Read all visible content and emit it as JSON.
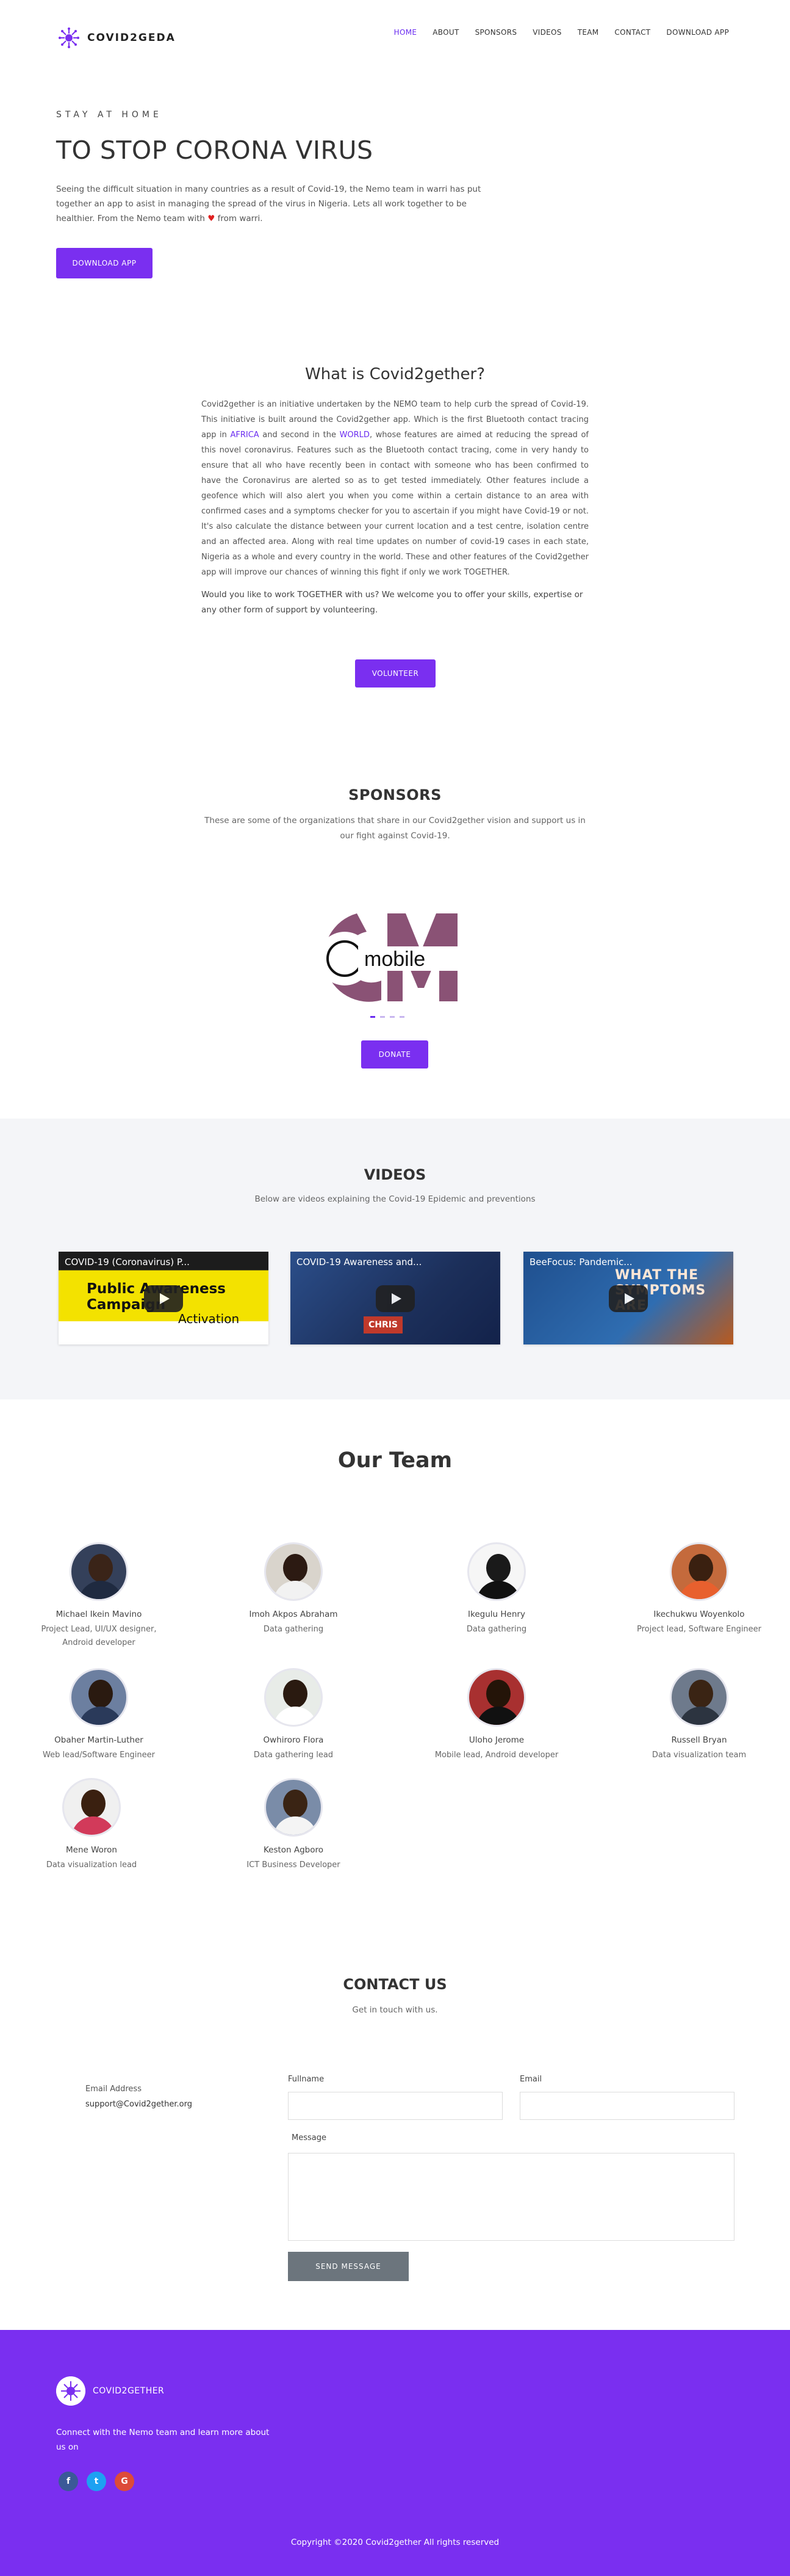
{
  "brand": {
    "name": "COVID2GEDA",
    "accent": "#7a2ff0"
  },
  "nav": {
    "items": [
      {
        "label": "HOME",
        "active": true
      },
      {
        "label": "ABOUT"
      },
      {
        "label": "SPONSORS"
      },
      {
        "label": "VIDEOS"
      },
      {
        "label": "TEAM"
      },
      {
        "label": "CONTACT"
      },
      {
        "label": "DOWNLOAD APP"
      }
    ]
  },
  "hero": {
    "kicker": "STAY AT HOME",
    "title": "TO STOP CORONA VIRUS",
    "text_before_heart": "Seeing the difficult situation in many countries as a result of Covid-19, the Nemo team in warri has put together an app to asist in managing the spread of the virus in Nigeria. Lets all work together to be healthier. From the Nemo team with",
    "heart": "♥",
    "text_after_heart": "from warri.",
    "button": "DOWNLOAD APP"
  },
  "what": {
    "title": "What is Covid2gether?",
    "p1": "Covid2gether is an initiative undertaken by the NEMO team to help curb the spread of Covid-19. This initiative is built around the Covid2gether app. Which is the first Bluetooth contact tracing app in",
    "hl1": "AFRICA",
    "p2": "and second in the",
    "hl2": "WORLD",
    "p3": ", whose features are aimed at reducing the spread of this novel coronavirus. Features such as the Bluetooth contact tracing, come in very handy to ensure that all who have recently been in contact with someone who has been confirmed to have the Coronavirus are alerted so as to get tested immediately. Other features include a geofence which will also alert you when you come within a certain distance to an area with confirmed cases and a symptoms checker for you to ascertain if you might have Covid-19 or not. It's also calculate the distance between your current location and a test centre, isolation centre and an affected area. Along with real time updates on number of covid-19 cases in each state, Nigeria as a whole and every country in the world. These and other features of the Covid2gether app will improve our chances of winning this fight if only we work TOGETHER.",
    "ask": "Would you like to work TOGETHER with us? We welcome you to offer your skills, expertise or any other form of support by volunteering.",
    "button": "VOLUNTEER"
  },
  "sponsors": {
    "title": "SPONSORS",
    "subtitle": "These are some of the organizations that share in our Covid2gether vision and support us in our fight against Covid-19.",
    "logo_text": "mobile",
    "carousel_index": 1,
    "carousel_count": 4,
    "button": "DONATE"
  },
  "videos": {
    "title": "VIDEOS",
    "subtitle": "Below are videos explaining the Covid-19 Epidemic and preventions",
    "items": [
      {
        "title": "COVID-19 (Coronavirus) P...",
        "overlay1": "Public Awareness Campaign",
        "overlay2": "Activation"
      },
      {
        "title": "COVID-19 Awareness and...",
        "overlay1": "CHRIS"
      },
      {
        "title": "BeeFocus: Pandemic...",
        "overlay1": "WHAT THE SYMPTOMS ARE"
      }
    ]
  },
  "team": {
    "title": "Our Team",
    "members": [
      {
        "name": "Michael Ikein Mavino",
        "role": "Project Lead, UI/UX designer, Android developer"
      },
      {
        "name": "Imoh Akpos Abraham",
        "role": "Data gathering"
      },
      {
        "name": "Ikegulu Henry",
        "role": "Data gathering"
      },
      {
        "name": "Ikechukwu Woyenkolo",
        "role": "Project lead, Software Engineer"
      },
      {
        "name": "Obaher Martin-Luther",
        "role": "Web lead/Software Engineer"
      },
      {
        "name": "Owhiroro Flora",
        "role": "Data gathering lead"
      },
      {
        "name": "Uloho Jerome",
        "role": "Mobile lead, Android developer"
      },
      {
        "name": "Russell Bryan",
        "role": "Data visualization team"
      },
      {
        "name": "Mene Woron",
        "role": "Data visualization lead"
      },
      {
        "name": "Keston Agboro",
        "role": "ICT Business Developer"
      }
    ]
  },
  "contact": {
    "title": "CONTACT US",
    "subtitle": "Get in touch with us.",
    "email_label": "Email Address",
    "email_value": "support@Covid2gether.org",
    "fullname_label": "Fullname",
    "email_field_label": "Email",
    "message_label": "Message",
    "button": "SEND MESSAGE"
  },
  "footer": {
    "brand": "COVID2GETHER",
    "text": "Connect with the Nemo team and learn more about us on",
    "socials": [
      {
        "icon": "facebook-icon",
        "glyph": "f",
        "color": "#3b5998"
      },
      {
        "icon": "twitter-icon",
        "glyph": "t",
        "color": "#1da1f2"
      },
      {
        "icon": "google-icon",
        "glyph": "G",
        "color": "#dd4b39"
      }
    ],
    "copyright": "Copyright ©2020 Covid2gether All rights reserved"
  }
}
